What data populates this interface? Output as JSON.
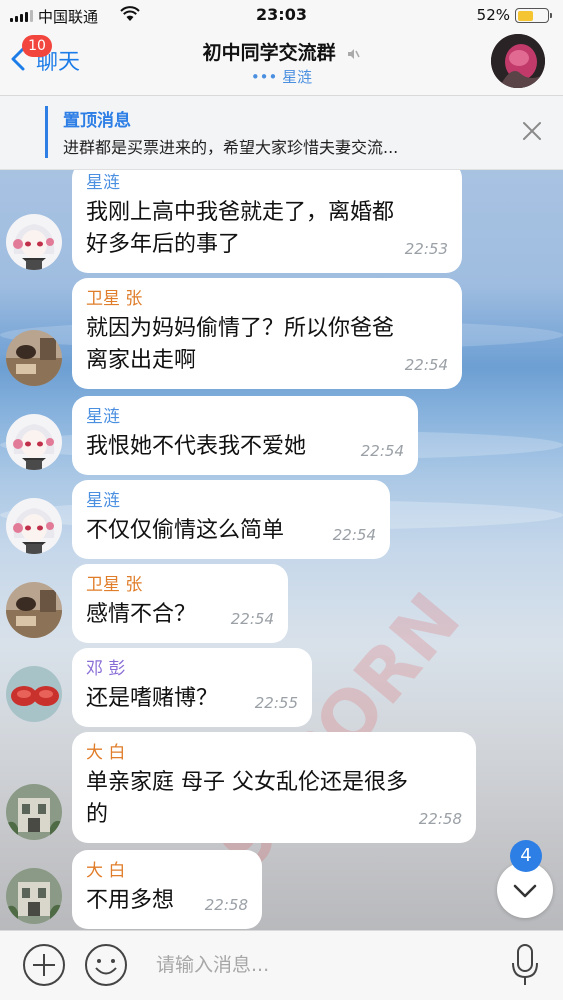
{
  "status_bar": {
    "carrier": "中国联通",
    "time": "23:03",
    "battery_percent": "52%",
    "battery_level": 0.52
  },
  "nav": {
    "back_badge": "10",
    "back_label": "聊天",
    "title": "初中同学交流群",
    "subtitle": "星涟"
  },
  "pinned": {
    "title": "置顶消息",
    "text": "进群都是买票进来的，希望大家珍惜夫妻交流..."
  },
  "messages": [
    {
      "sender": "星涟",
      "sender_color": "#4a8fe0",
      "lines": [
        "我刚上高中我爸就走了，离婚都",
        "好多年后的事了"
      ],
      "time": "22:53",
      "avatar": "anime-girl"
    },
    {
      "sender": "卫星 张",
      "sender_color": "#e07d2a",
      "lines": [
        "就因为妈妈偷情了？所以你爸爸",
        "离家出走啊"
      ],
      "time": "22:54",
      "avatar": "room-photo"
    },
    {
      "sender": "星涟",
      "sender_color": "#4a8fe0",
      "lines": [
        "我恨她不代表我不爱她"
      ],
      "time": "22:54",
      "avatar": "anime-girl"
    },
    {
      "sender": "星涟",
      "sender_color": "#4a8fe0",
      "lines": [
        "不仅仅偷情这么简单"
      ],
      "time": "22:54",
      "avatar": "anime-girl"
    },
    {
      "sender": "卫星 张",
      "sender_color": "#e07d2a",
      "lines": [
        "感情不合？"
      ],
      "time": "22:54",
      "avatar": "room-photo"
    },
    {
      "sender": "邓 彭",
      "sender_color": "#8a6ed6",
      "lines": [
        "还是嗜赌博？"
      ],
      "time": "22:55",
      "avatar": "red-objects"
    },
    {
      "sender": "大 白",
      "sender_color": "#e07d2a",
      "lines": [
        "单亲家庭 母子 父女乱伦还是很多",
        "的"
      ],
      "time": "22:58",
      "avatar": "building"
    },
    {
      "sender": "大 白",
      "sender_color": "#e07d2a",
      "lines": [
        "不用多想"
      ],
      "time": "22:58",
      "avatar": "building"
    }
  ],
  "watermark": "91PORN",
  "unread_jump_count": "4",
  "input": {
    "placeholder": "请输入消息..."
  }
}
